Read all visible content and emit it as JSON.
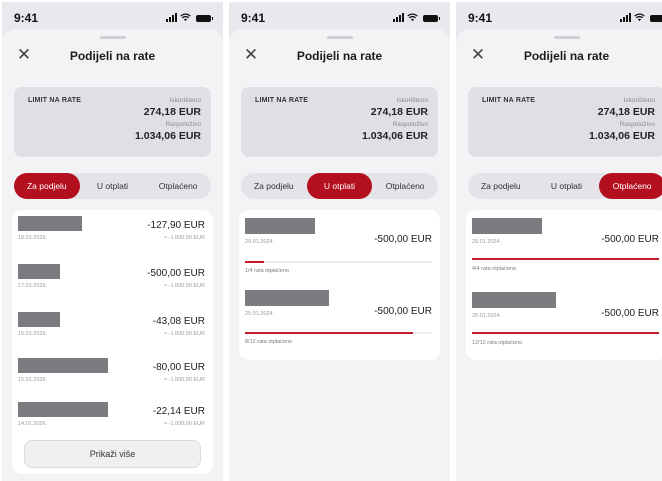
{
  "status": {
    "time": "9:41"
  },
  "colors": {
    "accent": "#b40f1f",
    "progress": "#c61a2a",
    "redacted": "#7b7b80"
  },
  "screens": [
    {
      "title": "Podijeli na rate",
      "limit": {
        "label": "LIMIT NA RATE",
        "used_label": "Iskorišteno",
        "used_value": "274,18 EUR",
        "avail_label": "Raspoloživo",
        "avail_value": "1.034,06 EUR"
      },
      "tabs": [
        "Za podjelu",
        "U otplati",
        "Otplaćeno"
      ],
      "active_tab": 0,
      "items": [
        {
          "date": "18.01.2026.",
          "amount": "-127,90 EUR",
          "sub": "≈ -1.000,00 EUR"
        },
        {
          "date": "17.01.2026.",
          "amount": "-500,00 EUR",
          "sub": "≈ -1.000,00 EUR"
        },
        {
          "date": "15.01.2026.",
          "amount": "-43,08 EUR",
          "sub": "≈ -1.000,00 EUR"
        },
        {
          "date": "15.01.2026.",
          "amount": "-80,00 EUR",
          "sub": "≈ -1.000,00 EUR"
        },
        {
          "date": "14.01.2026.",
          "amount": "-22,14 EUR",
          "sub": "≈ -1.000,00 EUR"
        }
      ],
      "more_button": "Prikaži više"
    },
    {
      "title": "Podijeli na rate",
      "limit": {
        "label": "LIMIT NA RATE",
        "used_label": "Iskorišteno",
        "used_value": "274,18 EUR",
        "avail_label": "Raspoloživo",
        "avail_value": "1.034,06 EUR"
      },
      "tabs": [
        "Za podjelu",
        "U otplati",
        "Otplaćeno"
      ],
      "active_tab": 1,
      "items": [
        {
          "date": "29.01.2024.",
          "amount": "-500,00 EUR",
          "progress": 0.1,
          "note": "1/4 rata otplaćeno"
        },
        {
          "date": "25.01.2024.",
          "amount": "-500,00 EUR",
          "progress": 0.9,
          "note": "8/12 rata otplaćeno"
        }
      ]
    },
    {
      "title": "Podijeli na rate",
      "limit": {
        "label": "LIMIT NA RATE",
        "used_label": "Iskorišteno",
        "used_value": "274,18 EUR",
        "avail_label": "Raspoloživo",
        "avail_value": "1.034,06 EUR"
      },
      "tabs": [
        "Za podjelu",
        "U otplati",
        "Otplaćeno"
      ],
      "active_tab": 2,
      "items": [
        {
          "date": "29.01.2024.",
          "amount": "-500,00 EUR",
          "progress": 1.0,
          "note": "4/4 rata otplaćeno"
        },
        {
          "date": "25.01.2024.",
          "amount": "-500,00 EUR",
          "progress": 1.0,
          "note": "12/12 rata otplaćeno"
        }
      ]
    }
  ]
}
